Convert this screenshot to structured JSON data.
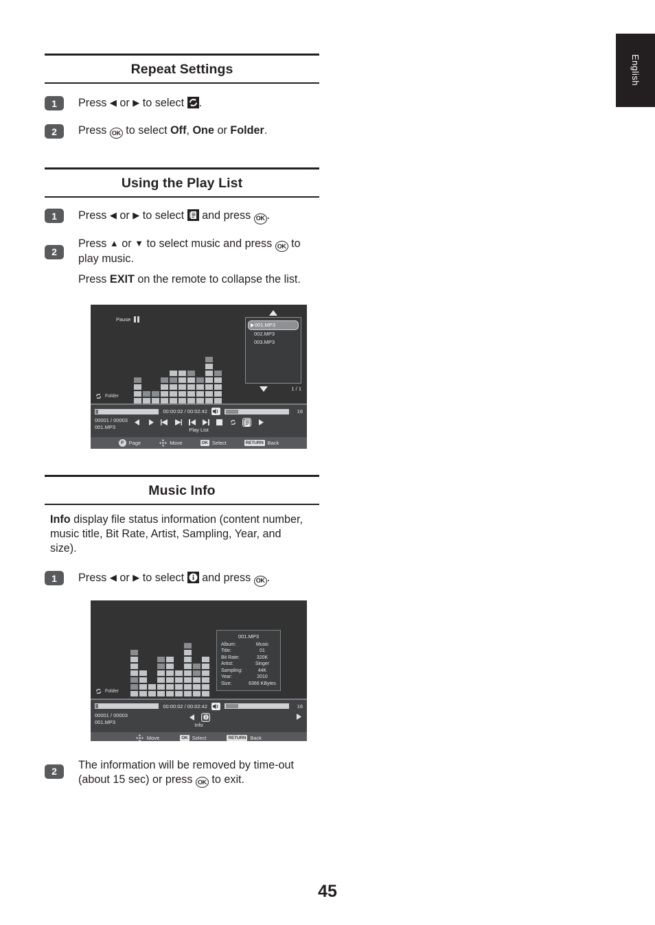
{
  "language_tab": "English",
  "page_number": "45",
  "sections": [
    {
      "id": "repeat-settings",
      "heading": "Repeat Settings",
      "steps": [
        {
          "num": "1",
          "text_before": "Press ",
          "text_after": " to select "
        },
        {
          "num": "2",
          "text": "Press "
        }
      ]
    },
    {
      "id": "using-play-list",
      "heading": "Using the Play List"
    },
    {
      "id": "music-info",
      "heading": "Music Info"
    }
  ],
  "repeat": {
    "heading": "Repeat Settings",
    "step1": {
      "num": "1",
      "a": "Press",
      "b": "or",
      "c": "to select",
      "icon": "repeat-icon",
      "end": "."
    },
    "step2": {
      "num": "2",
      "a": "Press",
      "b": "to select",
      "opt1": "Off",
      "sep1": ",",
      "opt2": "One",
      "sep2": "or",
      "opt3": "Folder",
      "end": "."
    }
  },
  "playlist_sec": {
    "heading": "Using the Play List",
    "step1": {
      "num": "1",
      "a": "Press",
      "b": "or",
      "c": "to select",
      "icon": "playlist-icon",
      "d": "and press",
      "end": "."
    },
    "step2": {
      "num": "2",
      "line1a": "Press",
      "line1b": "or",
      "line1c": "to select music and press",
      "line2": "to play music.",
      "p2a": "Press",
      "p2key": "EXIT",
      "p2b": "on the remote to collapse the list."
    }
  },
  "music_info_sec": {
    "heading": "Music Info",
    "paragraph_bold": "Info",
    "paragraph": " display file status information (content number, music title, Bit Rate, Artist, Sampling, Year, and size).",
    "step1": {
      "num": "1",
      "a": "Press",
      "b": "or",
      "c": "to select",
      "icon": "info-icon",
      "d": "and press",
      "end": "."
    },
    "step2": {
      "num": "2",
      "a": "The information will be removed by time-out (about 15 sec) or press",
      "b": "to exit."
    }
  },
  "glyphs": {
    "left_triangle": "◀",
    "right_triangle": "▶",
    "up_triangle": "▲",
    "down_triangle": "▼",
    "ok": "OK"
  },
  "tv_playlist_screen": {
    "status_label": "Pause",
    "status_icon": "pause-icon",
    "repeat_mode_icon": "repeat-icon",
    "repeat_mode_label": "Folder",
    "playlist": {
      "items": [
        {
          "label": "001.MP3",
          "selected": true
        },
        {
          "label": "002.MP3",
          "selected": false
        },
        {
          "label": "003.MP3",
          "selected": false
        }
      ],
      "page_indicator": "1 / 1",
      "scroll_up_icon": "scroll-up-icon",
      "scroll_down_icon": "scroll-down-icon"
    },
    "transport": {
      "elapsed_total": "00:00:02 / 00:02:42",
      "volume_icon": "speaker-icon",
      "volume_value": "16",
      "track_counter": "00001 / 00003",
      "track_name": "001.MP3",
      "selected_label": "Play List",
      "buttons": [
        "prev-arrow-icon",
        "play-icon",
        "rewind-icon",
        "fast-forward-icon",
        "skip-previous-icon",
        "skip-next-icon",
        "stop-icon",
        "repeat-icon",
        "playlist-icon",
        "next-arrow-icon"
      ]
    },
    "help": [
      {
        "key": "P",
        "label": "Page",
        "key_style": "round"
      },
      {
        "key": "dpad-icon",
        "label": "Move",
        "key_style": "pad"
      },
      {
        "key": "OK",
        "label": "Select",
        "key_style": "flat"
      },
      {
        "key": "RETURN",
        "label": "Back",
        "key_style": "flat"
      }
    ]
  },
  "tv_info_screen": {
    "repeat_mode_icon": "repeat-icon",
    "repeat_mode_label": "Folder",
    "info_panel": {
      "title": "001.MP3",
      "rows": [
        {
          "key": "Album:",
          "value": "Music"
        },
        {
          "key": "Title:",
          "value": "01"
        },
        {
          "key": "Bit Rate:",
          "value": "320K"
        },
        {
          "key": "Artist:",
          "value": "Singer"
        },
        {
          "key": "Sampling:",
          "value": "44K"
        },
        {
          "key": "Year:",
          "value": "2010"
        },
        {
          "key": "Size:",
          "value": "6366 KBytes"
        }
      ]
    },
    "transport": {
      "elapsed_total": "00:00:02 / 00:02:42",
      "volume_icon": "speaker-icon",
      "volume_value": "16",
      "track_counter": "00001 / 00003",
      "track_name": "001.MP3",
      "selected_label": "Info"
    },
    "help": [
      {
        "key": "dpad-icon",
        "label": "Move",
        "key_style": "pad"
      },
      {
        "key": "OK",
        "label": "Select",
        "key_style": "flat"
      },
      {
        "key": "RETURN",
        "label": "Back",
        "key_style": "flat"
      }
    ]
  },
  "colors": {
    "ink": "#231f20",
    "badge": "#595a5c",
    "tv_bg": "#333334",
    "tv_bar": "#414244",
    "tv_help": "#58595c",
    "eq_light": "#c3c5c8",
    "eq_dark": "#8a8c90"
  }
}
